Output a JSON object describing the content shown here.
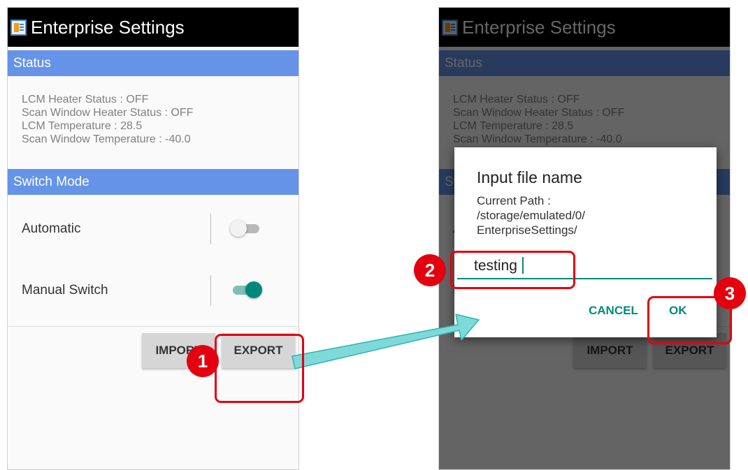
{
  "app": {
    "title": "Enterprise Settings"
  },
  "status": {
    "header": "Status",
    "lines": [
      "LCM Heater Status : OFF",
      "Scan Window Heater Status : OFF",
      "LCM Temperature : 28.5",
      "Scan Window Temperature : -40.0"
    ]
  },
  "switch_mode": {
    "header": "Switch Mode",
    "automatic_label": "Automatic",
    "automatic_on": false,
    "manual_label": "Manual Switch",
    "manual_on": true
  },
  "buttons": {
    "import_label": "IMPORT",
    "export_label": "EXPORT"
  },
  "dialog": {
    "title": "Input file name",
    "message_lines": [
      "Current Path :",
      "/storage/emulated/0/",
      "EnterpriseSettings/"
    ],
    "input_value": "testing",
    "cancel_label": "CANCEL",
    "ok_label": "OK"
  },
  "annotations": {
    "step1": "1",
    "step2": "2",
    "step3": "3"
  },
  "colors": {
    "section_header": "#6593e8",
    "accent": "#00897b",
    "annotation_red": "#e3000f",
    "arrow": "#7fd9d9"
  }
}
